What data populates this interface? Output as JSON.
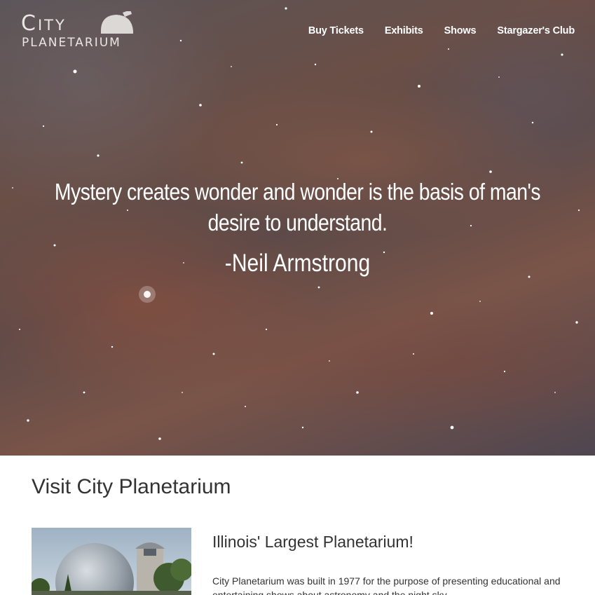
{
  "brand": {
    "line1": "City",
    "line2": "Planetarium",
    "colors": {
      "logo": "#e9e6e4",
      "nav_text": "#ffffff",
      "body_text": "#333333"
    }
  },
  "nav": {
    "items": [
      {
        "label": "Buy Tickets"
      },
      {
        "label": "Exhibits"
      },
      {
        "label": "Shows"
      },
      {
        "label": "Stargazer's Club"
      }
    ]
  },
  "hero": {
    "quote": "Mystery creates wonder and wonder is the basis of man's desire to understand.",
    "author": "-Neil Armstrong"
  },
  "visit": {
    "title": "Visit City Planetarium",
    "feature_title": "Illinois' Largest Planetarium!",
    "feature_text": "City Planetarium was built in 1977 for the purpose of presenting educational and entertaining shows about astronomy and the night sky."
  }
}
